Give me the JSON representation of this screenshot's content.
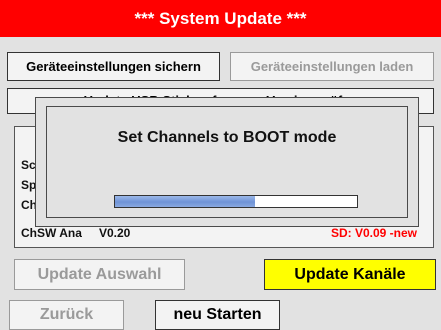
{
  "window": {
    "title": "*** System Update ***"
  },
  "buttons": {
    "save_settings": "Geräteeinstellungen sichern",
    "load_settings": "Geräteeinstellungen laden",
    "usb_check": "Update USB Stick auf neuere Version prüfen",
    "update_selection": "Update Auswahl",
    "update_channels": "Update Kanäle",
    "back": "Zurück",
    "restart": "neu Starten"
  },
  "info_panel": {
    "row_labels": [
      "Sc",
      "Sp",
      "Ch",
      "ChSW Ana"
    ],
    "chsw_value": "V0.20",
    "new_version_note": "SD: V0.09 -new"
  },
  "dialog": {
    "title": "Set Channels to BOOT mode",
    "progress": 0.58
  },
  "colors": {
    "titlebar": "#ff0000",
    "highlight_button": "#ffff00",
    "progress_fill": "#7a9ce0",
    "new_version_text": "#ff0000"
  }
}
